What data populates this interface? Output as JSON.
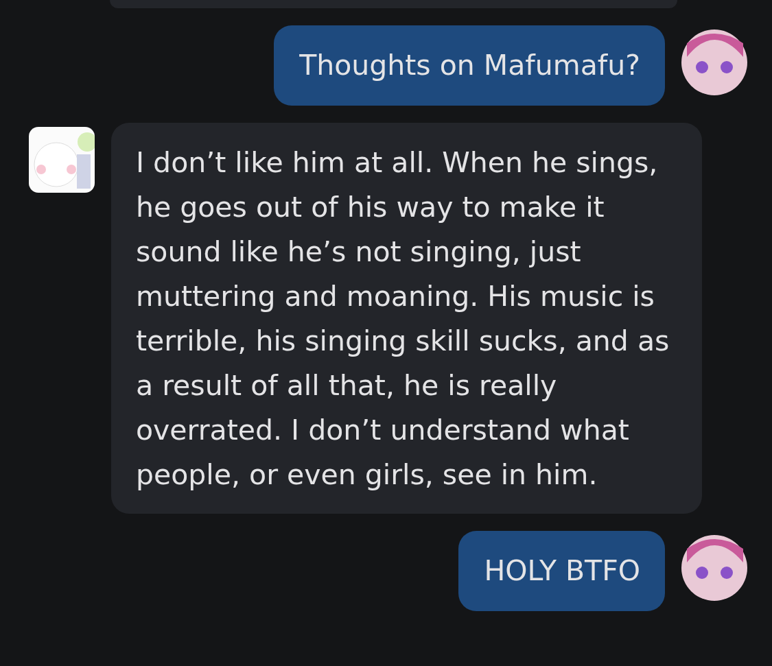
{
  "messages": [
    {
      "kind": "user",
      "text": "Thoughts on Mafumafu?"
    },
    {
      "kind": "bot",
      "text": "I don’t like him at all. When he sings, he goes out of his way to make it sound like he’s not singing, just muttering and moaning. His music is terrible, his singing skill sucks, and as a result of all that, he is really overrated. I don’t understand what people, or even girls, see in him."
    },
    {
      "kind": "user",
      "text": "HOLY BTFO"
    }
  ]
}
